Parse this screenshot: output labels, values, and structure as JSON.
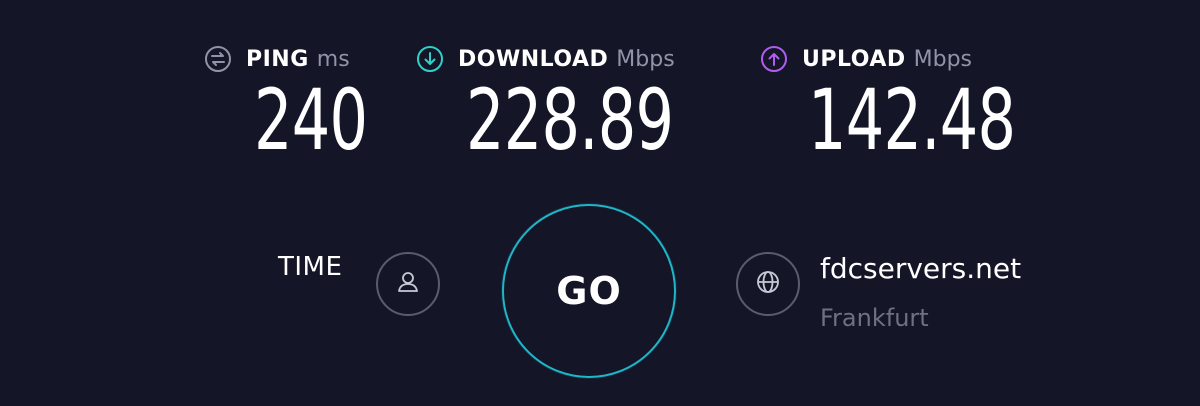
{
  "metrics": {
    "ping": {
      "label": "PING",
      "unit": "ms",
      "value": "240",
      "icon": "ping-icon",
      "icon_color": "#9193a8"
    },
    "download": {
      "label": "DOWNLOAD",
      "unit": "Mbps",
      "value": "228.89",
      "icon": "download-arrow-icon",
      "icon_color": "#2fd0c8"
    },
    "upload": {
      "label": "UPLOAD",
      "unit": "Mbps",
      "value": "142.48",
      "icon": "upload-arrow-icon",
      "icon_color": "#b05cf0"
    }
  },
  "time": {
    "label": "TIME",
    "icon": "user-icon"
  },
  "go_button": {
    "label": "GO",
    "ring_color": "#1fb6c8"
  },
  "server": {
    "name": "fdcservers.net",
    "location": "Frankfurt",
    "icon": "globe-icon"
  },
  "colors": {
    "background": "#141526",
    "text": "#ffffff",
    "muted": "#9193a8"
  }
}
